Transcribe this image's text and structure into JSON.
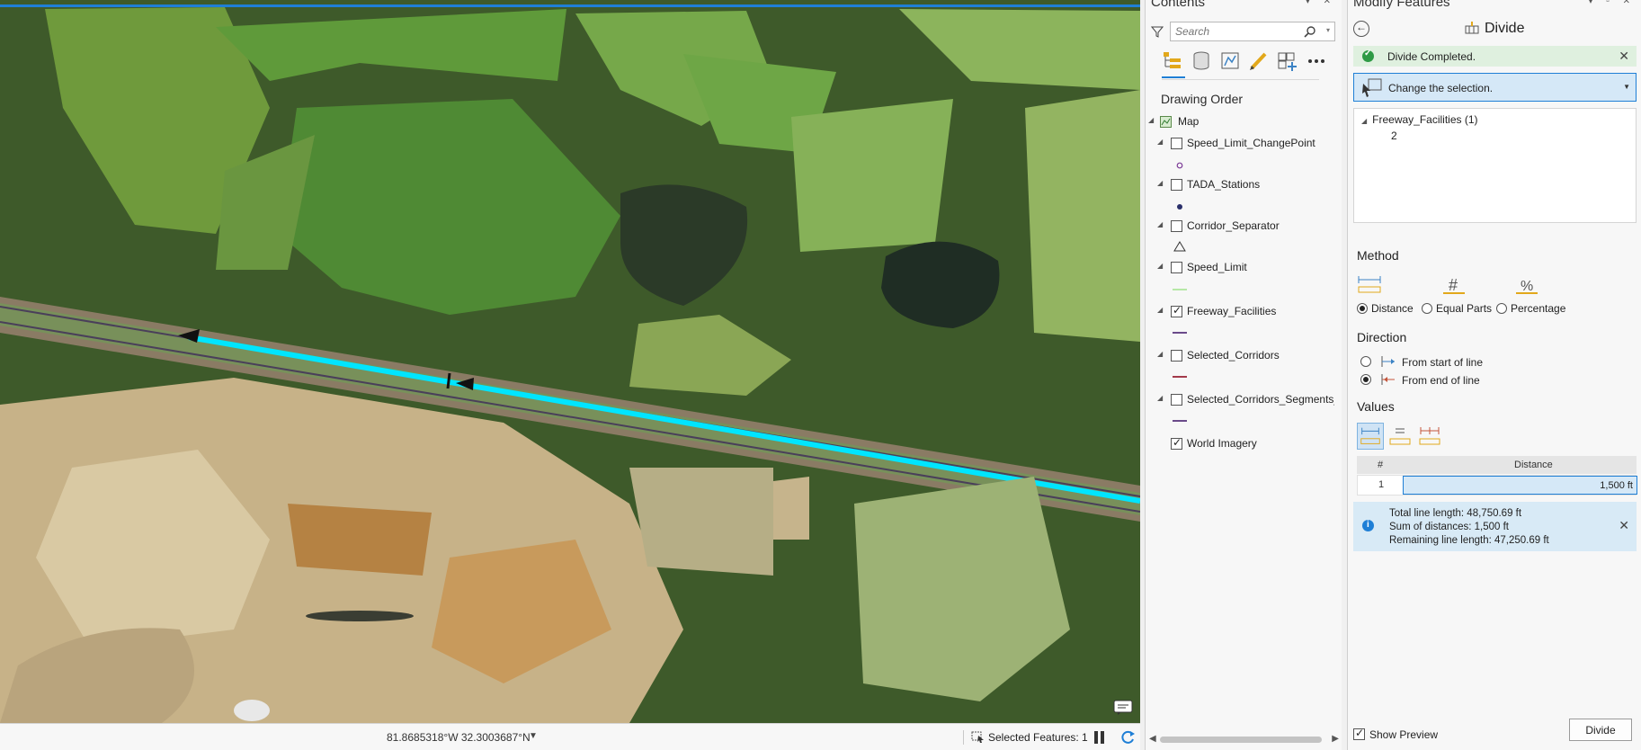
{
  "map": {
    "coordinates": "81.8685318°W 32.3003687°N",
    "selected_features": "Selected Features: 1"
  },
  "contents": {
    "title": "Contents",
    "search_placeholder": "Search",
    "drawing_order": "Drawing Order",
    "map_label": "Map",
    "layers": [
      {
        "name": "Speed_Limit_ChangePoint",
        "checked": false
      },
      {
        "name": "TADA_Stations",
        "checked": false
      },
      {
        "name": "Corridor_Separator",
        "checked": false
      },
      {
        "name": "Speed_Limit",
        "checked": false
      },
      {
        "name": "Freeway_Facilities",
        "checked": true
      },
      {
        "name": "Selected_Corridors",
        "checked": false
      },
      {
        "name": "Selected_Corridors_Segments_HC",
        "checked": false
      },
      {
        "name": "World Imagery",
        "checked": true
      }
    ]
  },
  "modify": {
    "title": "Modify Features",
    "tool": "Divide",
    "banner": "Divide Completed.",
    "selection_prompt": "Change the selection.",
    "tree_layer": "Freeway_Facilities (1)",
    "tree_item": "2",
    "method_title": "Method",
    "methods": [
      "Distance",
      "Equal Parts",
      "Percentage"
    ],
    "selected_method": "Distance",
    "direction_title": "Direction",
    "directions": [
      "From start of line",
      "From end of line"
    ],
    "selected_direction": "From end of line",
    "values_title": "Values",
    "table": {
      "col_index": "#",
      "col_distance": "Distance",
      "rows": [
        {
          "index": "1",
          "distance": "1,500 ft"
        }
      ]
    },
    "info": {
      "total": "Total line length: 48,750.69 ft",
      "sum": "Sum of distances: 1,500 ft",
      "remaining": "Remaining line length: 47,250.69 ft"
    },
    "show_preview": "Show Preview",
    "divide_button": "Divide"
  },
  "colors": {
    "accent": "#1f7fd6",
    "selection_highlight": "#00e5ff",
    "success": "#2e9a45"
  }
}
